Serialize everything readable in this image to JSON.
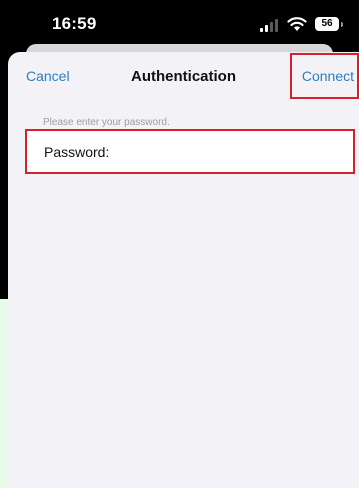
{
  "status_bar": {
    "time": "16:59",
    "battery": "56",
    "icons": [
      "signal-icon",
      "wifi-icon",
      "battery-icon"
    ]
  },
  "nav": {
    "cancel_label": "Cancel",
    "title": "Authentication",
    "connect_label": "Connect"
  },
  "form": {
    "hint": "Please enter your password.",
    "password_label": "Password:",
    "password_value": ""
  },
  "colors": {
    "accent": "#2c7fbe",
    "highlight": "#d6202a",
    "background": "#f2f2f7"
  }
}
